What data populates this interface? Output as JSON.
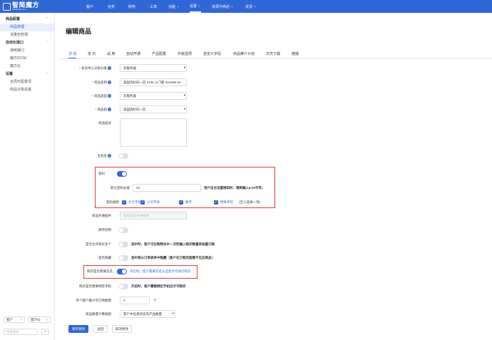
{
  "brand": {
    "name": "智简魔方",
    "sub": "IDCSmart.com"
  },
  "topnav": [
    {
      "label": "客户"
    },
    {
      "label": "业务"
    },
    {
      "label": "财务"
    },
    {
      "label": "工单"
    },
    {
      "label": "功能",
      "dropdown": true
    },
    {
      "label": "设置",
      "dropdown": true,
      "active": true
    },
    {
      "label": "资源与商店",
      "dropdown": true
    },
    {
      "label": "反馈",
      "dropdown": true
    }
  ],
  "sidebar": {
    "groups": [
      {
        "title": "商品配置",
        "items": [
          {
            "label": "商品管理",
            "active": true
          },
          {
            "label": "流量包管理"
          }
        ]
      },
      {
        "title": "自动化接口",
        "items": [
          {
            "label": "通用接口"
          },
          {
            "label": "魔方DCIM"
          },
          {
            "label": "魔方云"
          }
        ]
      },
      {
        "title": "设置",
        "items": [
          {
            "label": "全局可配置项"
          },
          {
            "label": "商品订购设置"
          }
        ]
      }
    ],
    "filter_a": "客户",
    "filter_b": "客户ID",
    "search_placeholder": "搜索搜索"
  },
  "page": {
    "title": "编辑商品"
  },
  "tabs": [
    {
      "label": "详 情",
      "active": true
    },
    {
      "label": "定 价"
    },
    {
      "label": "试 用"
    },
    {
      "label": "自动开通"
    },
    {
      "label": "产品配置"
    },
    {
      "label": "升级选项"
    },
    {
      "label": "自定义字段"
    },
    {
      "label": "商品推介计划"
    },
    {
      "label": "文件下载"
    },
    {
      "label": "链接"
    }
  ],
  "form": {
    "center_group": {
      "label": "会员中心分组分类",
      "value": "云服务器"
    },
    "product_name": {
      "label": "商品名称",
      "value": "美国洛杉矶一区 KVM 入门版 XeonE6 5v"
    },
    "product_type": {
      "label": "商品类型",
      "value": "云服务器"
    },
    "product_group": {
      "label": "商品组",
      "value": "美国洛杉矶一区"
    },
    "description": {
      "label": "商品描述"
    },
    "hostname": {
      "label": "主机名"
    },
    "password": {
      "label": "密码",
      "length_label": "默认密码长度",
      "length_value": "20",
      "length_hint": "用户自主设置密码时，限制输入6-20字符。",
      "rule_label": "密码规则",
      "rules": [
        "大写字母",
        "小写字母",
        "数字",
        "特殊字符"
      ],
      "rule_hint": "(至少选择一项)"
    },
    "plugin": {
      "label": "商品开通插件",
      "placeholder": "选择商品开通插件"
    },
    "stock": {
      "label": "库存控制"
    },
    "multi_qty": {
      "label": "是否允许购买多个",
      "hint": "选中时，客户可在购物车中一次性输入购买数量来批量订购"
    },
    "hidden": {
      "label": "是否隐藏",
      "hint": "选中则从订单表单中隐藏（客户在订购页面看不见这商品）"
    },
    "realname": {
      "label": "购买是否需要实名",
      "hint": "开启时，客户需要实名认证后才可进行购买"
    },
    "bind_phone": {
      "label": "购买是否需要绑定手机",
      "hint": "开启时，客户需要绑定手机后才可购买"
    },
    "max_qty": {
      "label": "单个客户最大可订购数量",
      "value": "0",
      "unit": "个"
    },
    "qty_rule": {
      "label": "商品数量计算规则",
      "value": "客户中任意状态的产品数量"
    }
  },
  "actions": {
    "save": "保存更改",
    "back": "返回",
    "cancel": "取消更改"
  }
}
